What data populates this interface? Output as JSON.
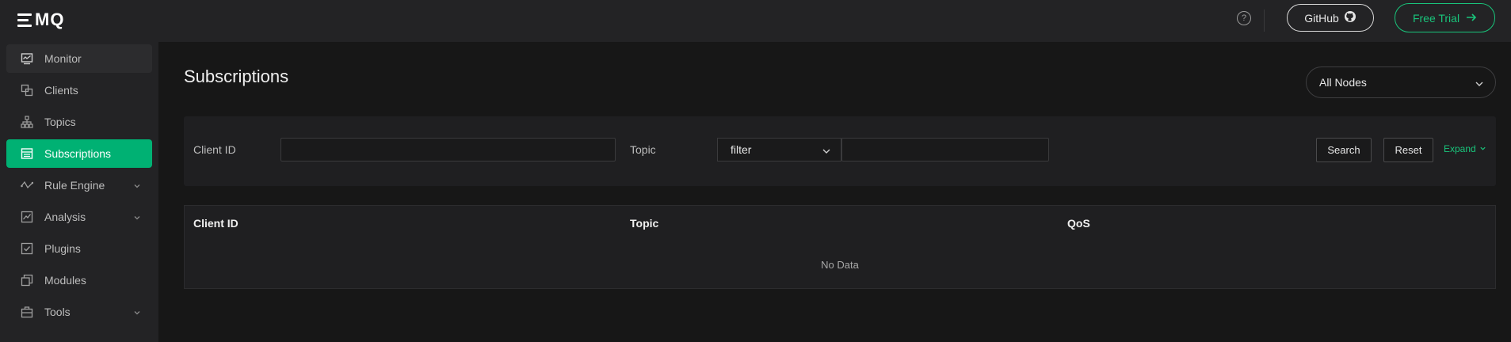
{
  "brand": {
    "logo_text": "MQ"
  },
  "sidebar": {
    "items": [
      {
        "label": "Monitor",
        "icon": "monitor-icon"
      },
      {
        "label": "Clients",
        "icon": "clients-icon"
      },
      {
        "label": "Topics",
        "icon": "topics-icon"
      },
      {
        "label": "Subscriptions",
        "icon": "subscriptions-icon",
        "active": true
      },
      {
        "label": "Rule Engine",
        "icon": "rule-engine-icon",
        "expandable": true
      },
      {
        "label": "Analysis",
        "icon": "analysis-icon",
        "expandable": true
      },
      {
        "label": "Plugins",
        "icon": "plugins-icon"
      },
      {
        "label": "Modules",
        "icon": "modules-icon"
      },
      {
        "label": "Tools",
        "icon": "tools-icon",
        "expandable": true
      }
    ]
  },
  "header": {
    "help_icon": "question-circle-icon",
    "help_glyph": "?",
    "github_label": "GitHub",
    "trial_label": "Free Trial"
  },
  "main": {
    "title": "Subscriptions",
    "node_select": "All Nodes",
    "filters": {
      "client_id_label": "Client ID",
      "client_id_value": "",
      "topic_label": "Topic",
      "topic_mode": "filter",
      "topic_value": "",
      "search_label": "Search",
      "reset_label": "Reset",
      "expand_label": "Expand"
    },
    "table": {
      "columns": [
        "Client ID",
        "Topic",
        "QoS"
      ],
      "rows": [],
      "empty_text": "No Data"
    }
  },
  "colors": {
    "accent": "#00b173",
    "accent_text": "#19c47b",
    "background": "#171717",
    "sidebar": "#232325"
  }
}
